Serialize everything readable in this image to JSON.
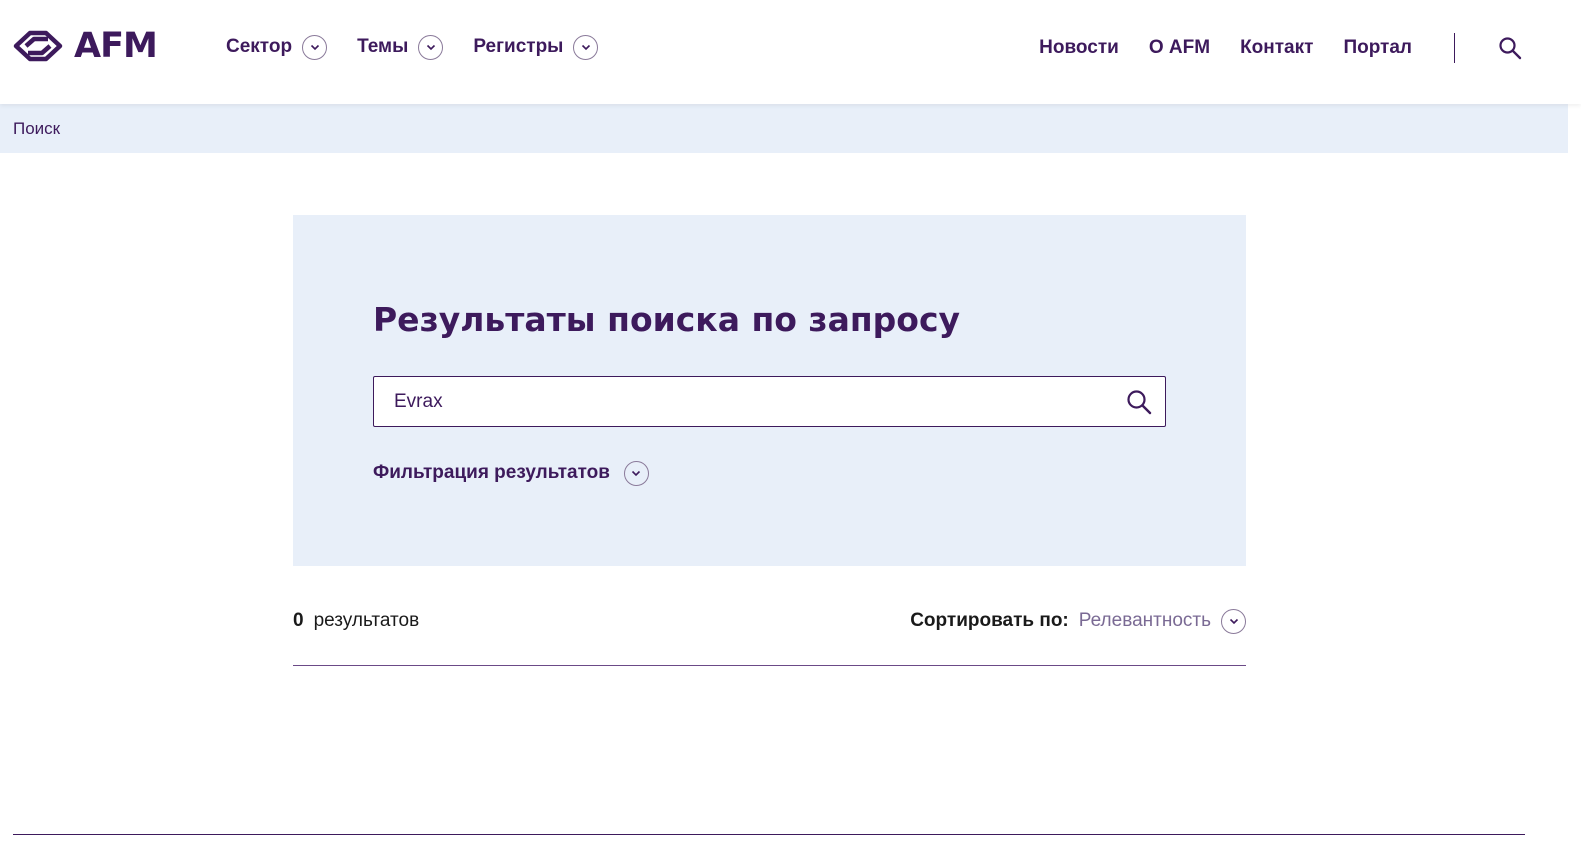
{
  "header": {
    "logo_text": "AFM",
    "nav_left": [
      {
        "label": "Сектор"
      },
      {
        "label": "Темы"
      },
      {
        "label": "Регистры"
      }
    ],
    "nav_right": [
      {
        "label": "Новости"
      },
      {
        "label": "О AFM"
      },
      {
        "label": "Контакт"
      },
      {
        "label": "Портал"
      }
    ]
  },
  "breadcrumb": {
    "current": "Поиск"
  },
  "search": {
    "title": "Результаты поиска по запросу",
    "query": "Evrax",
    "filter_label": "Фильтрация результатов"
  },
  "results": {
    "count": "0",
    "count_label": "результатов",
    "sort_label": "Сортировать по:",
    "sort_value": "Релевантность"
  },
  "colors": {
    "brand": "#3d1a5c",
    "panel_bg": "#e8eff9",
    "muted": "#7a6a94"
  },
  "icons": {
    "logo": "afm-logo-icon",
    "search": "search-icon",
    "chevron": "chevron-down-icon"
  }
}
